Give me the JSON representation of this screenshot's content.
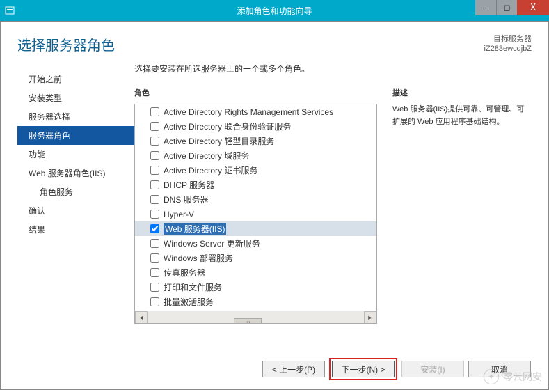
{
  "window": {
    "title": "添加角色和功能向导",
    "min": "—",
    "max": "□",
    "close": "X"
  },
  "header": {
    "page_title": "选择服务器角色",
    "target_label": "目标服务器",
    "target_value": "iZ283ewcdjbZ"
  },
  "nav": {
    "items": [
      {
        "label": "开始之前"
      },
      {
        "label": "安装类型"
      },
      {
        "label": "服务器选择"
      },
      {
        "label": "服务器角色",
        "active": true
      },
      {
        "label": "功能"
      },
      {
        "label": "Web 服务器角色(IIS)"
      },
      {
        "label": "角色服务",
        "sub": true
      },
      {
        "label": "确认"
      },
      {
        "label": "结果"
      }
    ]
  },
  "main": {
    "instruction": "选择要安装在所选服务器上的一个或多个角色。",
    "roles_label": "角色",
    "desc_label": "描述",
    "desc_text": "Web 服务器(IIS)提供可靠、可管理、可扩展的 Web 应用程序基础结构。",
    "roles": [
      {
        "label": "Active Directory Rights Management Services",
        "checked": false
      },
      {
        "label": "Active Directory 联合身份验证服务",
        "checked": false
      },
      {
        "label": "Active Directory 轻型目录服务",
        "checked": false
      },
      {
        "label": "Active Directory 域服务",
        "checked": false
      },
      {
        "label": "Active Directory 证书服务",
        "checked": false
      },
      {
        "label": "DHCP 服务器",
        "checked": false
      },
      {
        "label": "DNS 服务器",
        "checked": false
      },
      {
        "label": "Hyper-V",
        "checked": false
      },
      {
        "label": "Web 服务器(IIS)",
        "checked": true,
        "selected": true
      },
      {
        "label": "Windows Server 更新服务",
        "checked": false
      },
      {
        "label": "Windows 部署服务",
        "checked": false
      },
      {
        "label": "传真服务器",
        "checked": false
      },
      {
        "label": "打印和文件服务",
        "checked": false
      },
      {
        "label": "批量激活服务",
        "checked": false
      }
    ]
  },
  "footer": {
    "prev": "< 上一步(P)",
    "next": "下一步(N) >",
    "install": "安装(I)",
    "cancel": "取消"
  },
  "watermark": "零云网安"
}
